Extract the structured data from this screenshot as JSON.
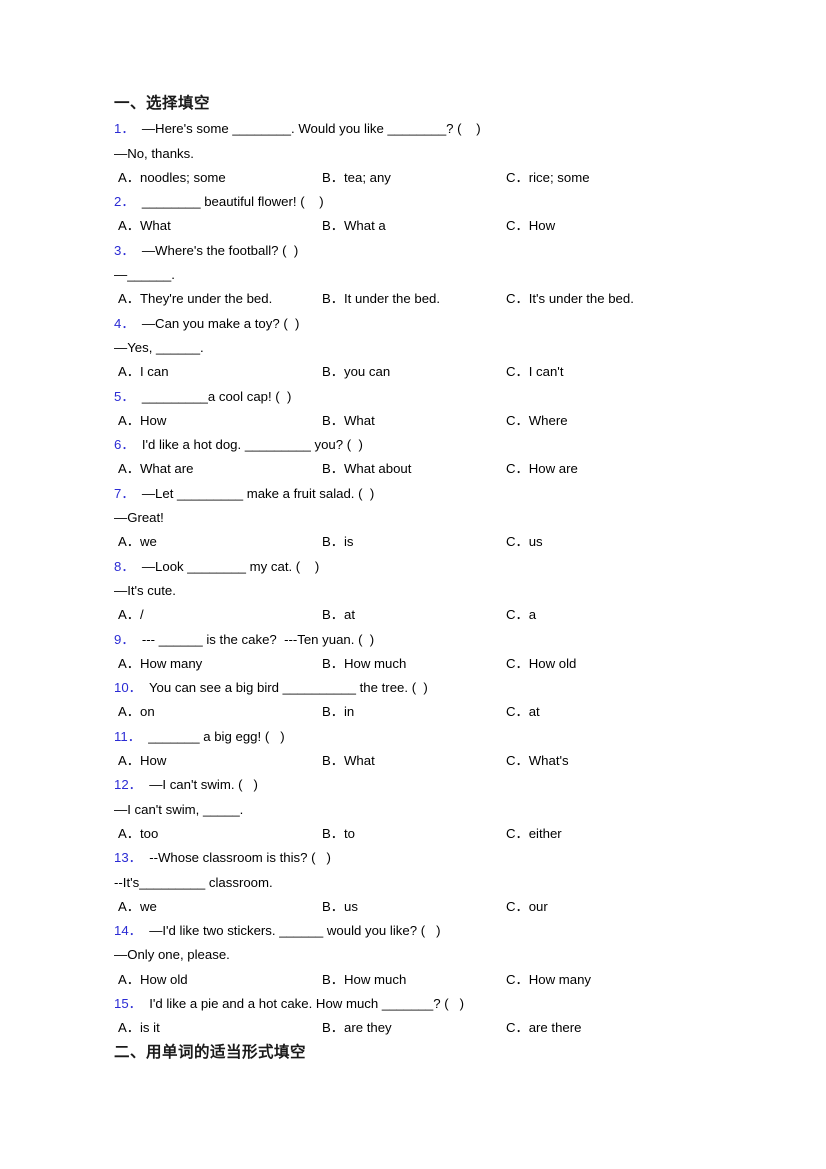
{
  "document": {
    "sections": [
      {
        "id": "section-one",
        "heading": "一、选择填空",
        "questions": [
          {
            "number": "1．",
            "stem": "—Here's some ________. Would you like ________? (    )",
            "continuation": "—No, thanks.",
            "options": [
              "A．noodles; some",
              "B．tea; any",
              "C．rice; some"
            ]
          },
          {
            "number": "2．",
            "stem": "________ beautiful flower! (    )",
            "continuation": "",
            "options": [
              "A．What",
              "B．What a",
              "C．How"
            ]
          },
          {
            "number": "3．",
            "stem": "—Where's the football? (  )",
            "continuation": "—______.",
            "options": [
              "A．They're under the bed.",
              "B．It under the bed.",
              "C．It's under the bed."
            ]
          },
          {
            "number": "4．",
            "stem": "—Can you make a toy? (  )",
            "continuation": "—Yes, ______.",
            "options": [
              "A．I can",
              "B．you can",
              "C．I can't"
            ]
          },
          {
            "number": "5．",
            "stem": "_________a cool cap! (  )",
            "continuation": "",
            "options": [
              "A．How",
              "B．What",
              "C．Where"
            ]
          },
          {
            "number": "6．",
            "stem": "I'd like a hot dog. _________ you? (  )",
            "continuation": "",
            "options": [
              "A．What are",
              "B．What about",
              "C．How are"
            ]
          },
          {
            "number": "7．",
            "stem": "—Let _________ make a fruit salad. (  )",
            "continuation": "—Great!",
            "options": [
              "A．we",
              "B．is",
              "C．us"
            ]
          },
          {
            "number": "8．",
            "stem": "—Look ________ my cat. (    )",
            "continuation": "—It's cute.",
            "options": [
              "A．/",
              "B．at",
              "C．a"
            ]
          },
          {
            "number": "9．",
            "stem": "--- ______ is the cake?  ---Ten yuan. (  )",
            "continuation": "",
            "options": [
              "A．How many",
              "B．How much",
              "C．How old"
            ]
          },
          {
            "number": "10．",
            "stem": "You can see a big bird __________ the tree. (  )",
            "continuation": "",
            "options": [
              "A．on",
              "B．in",
              "C．at"
            ]
          },
          {
            "number": "11．",
            "stem": "_______ a big egg! (   )",
            "continuation": "",
            "options": [
              "A．How",
              "B．What",
              "C．What's"
            ]
          },
          {
            "number": "12．",
            "stem": "—I can't swim. (   )",
            "continuation": "—I can't swim, _____.",
            "options": [
              "A．too",
              "B．to",
              "C．either"
            ]
          },
          {
            "number": "13．",
            "stem": "--Whose classroom is this? (   )",
            "continuation": "--It's_________ classroom.",
            "options": [
              "A．we",
              "B．us",
              "C．our"
            ]
          },
          {
            "number": "14．",
            "stem": "—I'd like two stickers. ______ would you like? (   )",
            "continuation": "—Only one, please.",
            "options": [
              "A．How old",
              "B．How much",
              "C．How many"
            ]
          },
          {
            "number": "15．",
            "stem": "I'd like a pie and a hot cake. How much _______? (   )",
            "continuation": "",
            "options": [
              "A．is it",
              "B．are they",
              "C．are there"
            ]
          }
        ]
      },
      {
        "id": "section-two",
        "heading": "二、用单词的适当形式填空",
        "questions": []
      }
    ]
  }
}
